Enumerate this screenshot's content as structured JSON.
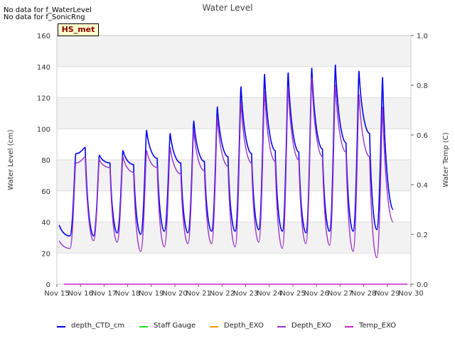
{
  "notes": [
    "No data for f_WaterLevel",
    "No data for f_SonicRng"
  ],
  "badge": "HS_met",
  "chart_data": {
    "type": "line",
    "title": "Water Level",
    "ylabel": "Water Level (cm)",
    "y2label": "Water Temp (C)",
    "ylim": [
      0,
      160
    ],
    "y2lim": [
      0,
      1.0
    ],
    "yticks": [
      0,
      20,
      40,
      60,
      80,
      100,
      120,
      140,
      160
    ],
    "y2ticks": [
      0.0,
      0.2,
      0.4,
      0.6,
      0.8,
      1.0
    ],
    "xlim": [
      15,
      30
    ],
    "xticks": [
      "Nov 15",
      "Nov 16",
      "Nov 17",
      "Nov 18",
      "Nov 19",
      "Nov 20",
      "Nov 21",
      "Nov 22",
      "Nov 23",
      "Nov 24",
      "Nov 25",
      "Nov 26",
      "Nov 27",
      "Nov 28",
      "Nov 29",
      "Nov 30"
    ],
    "grid": true,
    "legend_position": "bottom",
    "tide_peaks": {
      "x": [
        15.1,
        15.8,
        16.2,
        16.8,
        17.25,
        17.8,
        18.25,
        18.8,
        19.25,
        19.8,
        20.25,
        20.8,
        21.25,
        21.8,
        22.25,
        22.8,
        23.25,
        23.8,
        24.25,
        24.8,
        25.25,
        25.8,
        26.25,
        26.8,
        27.25,
        27.8,
        28.25,
        28.8,
        29.25
      ],
      "depth_CTD_cm": [
        38,
        84,
        88,
        83,
        78,
        86,
        77,
        99,
        81,
        97,
        78,
        105,
        79,
        114,
        82,
        127,
        84,
        135,
        86,
        136,
        85,
        139,
        87,
        141,
        91,
        137,
        97,
        133,
        48
      ],
      "Depth_EXO": [
        28,
        78,
        82,
        80,
        75,
        82,
        72,
        86,
        75,
        88,
        71,
        99,
        73,
        107,
        76,
        117,
        78,
        124,
        79,
        127,
        80,
        133,
        82,
        128,
        85,
        122,
        82,
        114,
        40
      ]
    },
    "tide_troughs": {
      "x": [
        15.55,
        16.55,
        17.55,
        18.55,
        19.55,
        20.55,
        21.55,
        22.55,
        23.55,
        24.55,
        25.55,
        26.55,
        27.55,
        28.55
      ],
      "depth_CTD_cm": [
        31,
        31,
        33,
        32,
        34,
        33,
        34,
        34,
        35,
        34,
        33,
        34,
        34,
        35
      ],
      "Depth_EXO": [
        23,
        28,
        27,
        21,
        24,
        26,
        26,
        24,
        27,
        23,
        26,
        25,
        21,
        17
      ]
    },
    "temp_line": {
      "x": [
        15.3,
        29.85
      ],
      "y": [
        0.0,
        0.0
      ]
    },
    "series": [
      {
        "name": "depth_CTD_cm",
        "color": "#0000ee"
      },
      {
        "name": "Staff Gauge",
        "color": "#22dd22"
      },
      {
        "name": "Depth_EXO",
        "color": "#ff9900"
      },
      {
        "name": "Depth_EXO",
        "color": "#9933cc"
      },
      {
        "name": "Temp_EXO",
        "color": "#cc22cc"
      }
    ]
  }
}
